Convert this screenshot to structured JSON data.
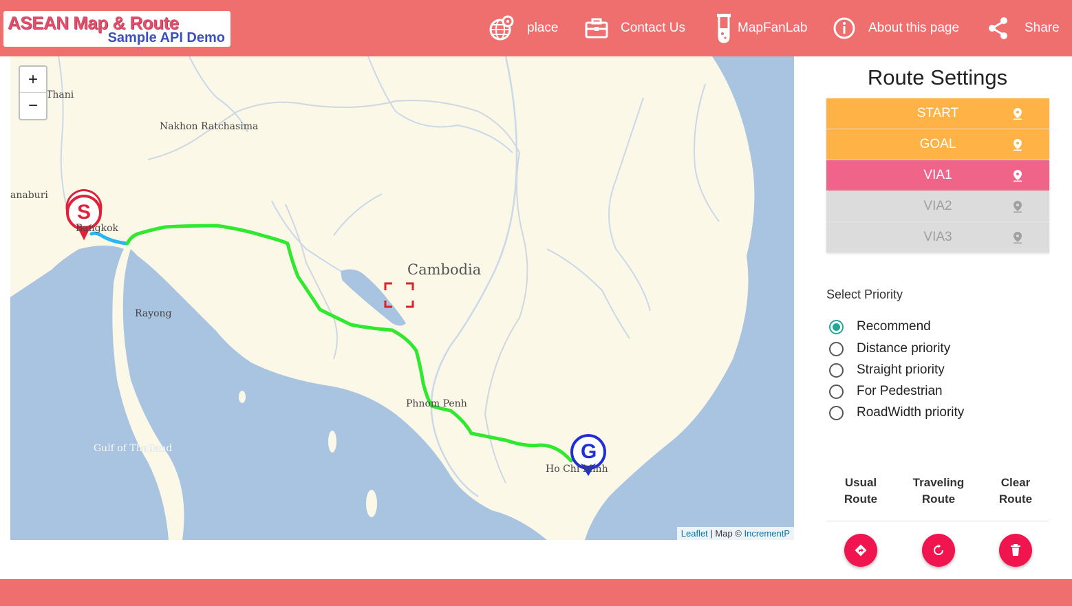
{
  "header": {
    "logo_title": "ASEAN Map & Route",
    "logo_subtitle": "Sample API Demo",
    "nav": [
      {
        "label": "place",
        "icon": "globe-pin-icon"
      },
      {
        "label": "Contact Us",
        "icon": "briefcase-icon"
      },
      {
        "label": "MapFanLab",
        "icon": "test-tube-icon"
      },
      {
        "label": "About this page",
        "icon": "info-icon"
      },
      {
        "label": "Share",
        "icon": "share-icon"
      }
    ]
  },
  "map": {
    "zoom_in": "+",
    "zoom_out": "−",
    "country_label": "Cambodia",
    "place_labels": [
      "Thani",
      "Nakhon Ratchasima",
      "anaburi",
      "Bangkok",
      "Rayong",
      "Phnom Penh",
      "Ho Chi Minh"
    ],
    "sea_label": "Gulf of Thailand",
    "start_marker": "S",
    "goal_marker": "G",
    "attribution": {
      "leaflet": "Leaflet",
      "sep": "| Map ©",
      "provider": "IncrementP"
    }
  },
  "panel": {
    "title": "Route Settings",
    "points": [
      {
        "label": "START",
        "state": "active"
      },
      {
        "label": "GOAL",
        "state": "active"
      },
      {
        "label": "VIA1",
        "state": "selected"
      },
      {
        "label": "VIA2",
        "state": "disabled"
      },
      {
        "label": "VIA3",
        "state": "disabled"
      }
    ],
    "priority_title": "Select Priority",
    "priorities": [
      {
        "label": "Recommend",
        "checked": true
      },
      {
        "label": "Distance priority",
        "checked": false
      },
      {
        "label": "Straight priority",
        "checked": false
      },
      {
        "label": "For Pedestrian",
        "checked": false
      },
      {
        "label": "RoadWidth priority",
        "checked": false
      }
    ],
    "actions": [
      {
        "line1": "Usual",
        "line2": "Route",
        "icon": "route-sign-icon"
      },
      {
        "line1": "Traveling",
        "line2": "Route",
        "icon": "refresh-icon"
      },
      {
        "line1": "Clear",
        "line2": "Route",
        "icon": "trash-icon"
      }
    ]
  },
  "colors": {
    "header": "#ef6e6e",
    "start_goal_button": "#ffb347",
    "via_selected": "#f0648a",
    "route": "#2fe82f",
    "fab": "#f0154f",
    "radio_checked": "#26a69a"
  }
}
